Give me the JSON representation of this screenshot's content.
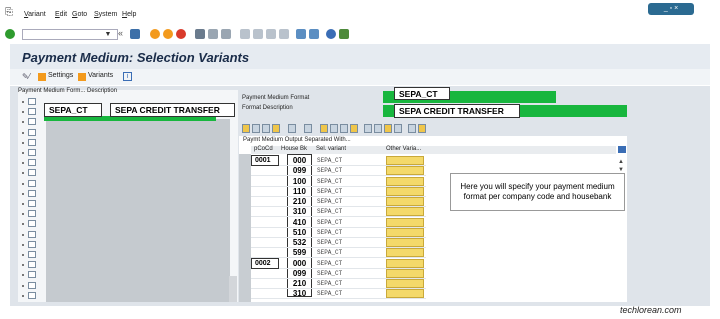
{
  "menu": [
    "Variant",
    "Edit",
    "Goto",
    "System",
    "Help"
  ],
  "page_title": "Payment Medium: Selection Variants",
  "app_toolbar": {
    "settings": "Settings",
    "variants": "Variants"
  },
  "left_pane": {
    "header": "Payment Medium Form...   Description",
    "selected_code": "SEPA_CT",
    "selected_desc": "SEPA CREDIT TRANSFER"
  },
  "form": {
    "format_label": "Payment Medium Format",
    "format_value": "SEPA_CT",
    "desc_label": "Format Description",
    "desc_value": "SEPA CREDIT TRANSFER"
  },
  "grid": {
    "title": "Paymt Medium Output Separated With...",
    "headers": [
      "pCoCd",
      "House Bk",
      "Sel. variant",
      "Other Varia..."
    ],
    "rows": [
      {
        "cocd": "0001",
        "bank": "000",
        "variant": "SEPA_CT"
      },
      {
        "cocd": "",
        "bank": "099",
        "variant": "SEPA_CT"
      },
      {
        "cocd": "",
        "bank": "100",
        "variant": "SEPA_CT"
      },
      {
        "cocd": "",
        "bank": "110",
        "variant": "SEPA_CT"
      },
      {
        "cocd": "",
        "bank": "210",
        "variant": "SEPA_CT"
      },
      {
        "cocd": "",
        "bank": "310",
        "variant": "SEPA_CT"
      },
      {
        "cocd": "",
        "bank": "410",
        "variant": "SEPA_CT"
      },
      {
        "cocd": "",
        "bank": "510",
        "variant": "SEPA_CT"
      },
      {
        "cocd": "",
        "bank": "532",
        "variant": "SEPA_CT"
      },
      {
        "cocd": "",
        "bank": "599",
        "variant": "SEPA_CT"
      },
      {
        "cocd": "0002",
        "bank": "000",
        "variant": "SEPA_CT"
      },
      {
        "cocd": "",
        "bank": "099",
        "variant": "SEPA_CT"
      },
      {
        "cocd": "",
        "bank": "210",
        "variant": "SEPA_CT"
      },
      {
        "cocd": "",
        "bank": "310",
        "variant": "SEPA_CT"
      }
    ]
  },
  "callout": "Here you will specify your payment medium format per company code and housebank",
  "watermark": "techlorean.com",
  "colors": {
    "accent_green": "#18b63e",
    "title_bg": "#e6ebf1",
    "content_bg": "#dfe4ea"
  }
}
